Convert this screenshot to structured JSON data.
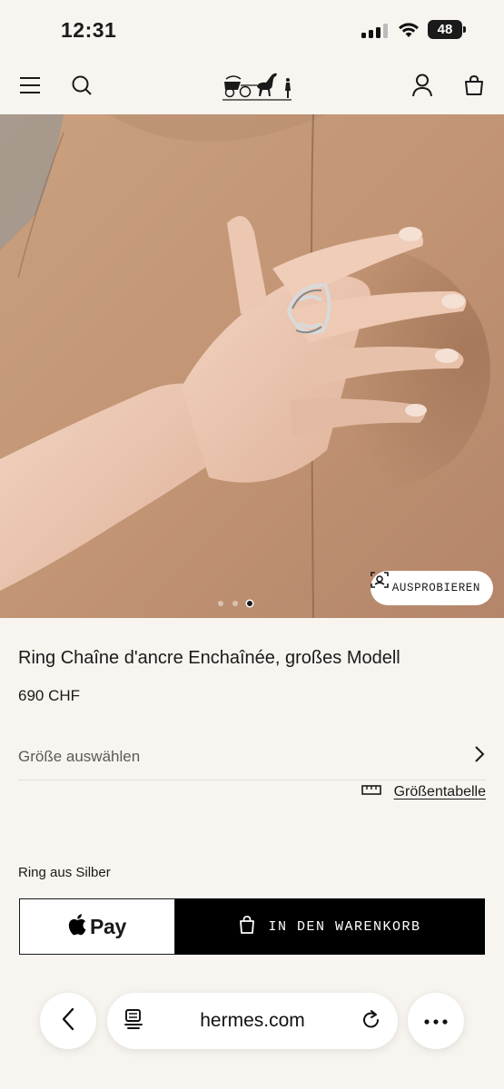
{
  "status_bar": {
    "time": "12:31",
    "battery": "48"
  },
  "header": {
    "menu_icon": "hamburger-icon",
    "search_icon": "search-icon",
    "logo": "hermes-carriage-logo",
    "account_icon": "user-icon",
    "bag_icon": "shopping-bag-icon"
  },
  "hero": {
    "try_on_label": "AUSPROBIEREN",
    "carousel": {
      "count": 3,
      "active": 3
    }
  },
  "product": {
    "title": "Ring Chaîne d'ancre Enchaînée, großes Modell",
    "price": "690 CHF",
    "size_select_label": "Größe auswählen",
    "size_chart_label": "Größentabelle",
    "material": "Ring aus Silber",
    "apple_pay_label": "Pay",
    "add_to_cart_label": "IN DEN WARENKORB"
  },
  "browser": {
    "url": "hermes.com"
  },
  "colors": {
    "background": "#f8f5f0",
    "leather": "#c29574",
    "primary_button": "#000000"
  }
}
